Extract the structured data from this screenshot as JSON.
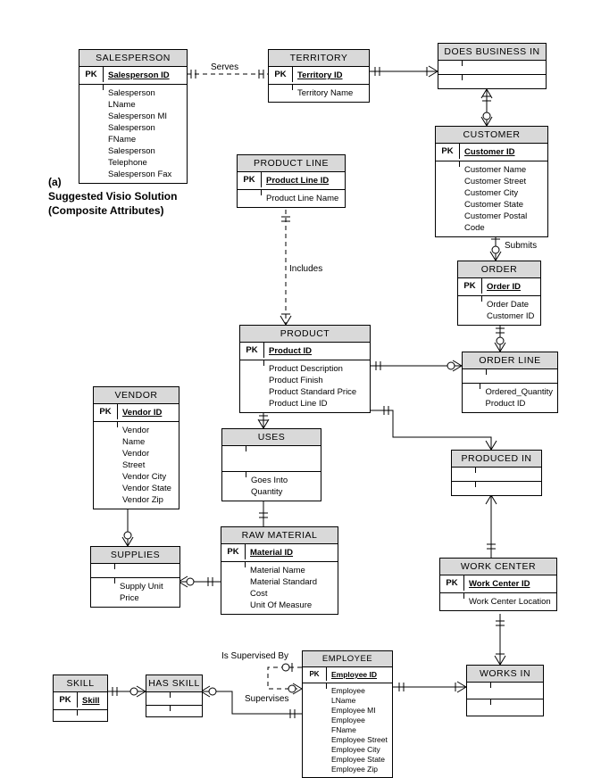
{
  "caption": {
    "a": "(a)",
    "l1": "Suggested Visio Solution",
    "l2": "(Composite Attributes)"
  },
  "labels": {
    "serves": "Serves",
    "includes": "Includes",
    "submits": "Submits",
    "supervisedBy": "Is Supervised By",
    "supervises": "Supervises"
  },
  "pk": "PK",
  "salesperson": {
    "title": "SALESPERSON",
    "key": "Salesperson ID",
    "attrs": "Salesperson LName\nSalesperson MI\nSalesperson FName\nSalesperson Telephone\nSalesperson Fax"
  },
  "territory": {
    "title": "TERRITORY",
    "key": "Territory ID",
    "attrs": "Territory Name"
  },
  "doesBusinessIn": {
    "title": "DOES BUSINESS IN"
  },
  "customer": {
    "title": "CUSTOMER",
    "key": "Customer ID",
    "attrs": "Customer Name\nCustomer Street\nCustomer City\nCustomer State\nCustomer Postal Code"
  },
  "productLine": {
    "title": "PRODUCT LINE",
    "key": "Product Line ID",
    "attrs": "Product Line Name"
  },
  "order": {
    "title": "ORDER",
    "key": "Order ID",
    "attrs": "Order Date\nCustomer ID"
  },
  "orderLine": {
    "title": "ORDER LINE",
    "attrs": "Ordered_Quantity\nProduct ID"
  },
  "product": {
    "title": "PRODUCT",
    "key": "Product ID",
    "attrs": "Product Description\nProduct Finish\nProduct Standard Price\nProduct Line ID"
  },
  "vendor": {
    "title": "VENDOR",
    "key": "Vendor ID",
    "attrs": "Vendor Name\nVendor Street\nVendor City\nVendor State\nVendor Zip"
  },
  "uses": {
    "title": "USES",
    "attrs": "Goes Into Quantity"
  },
  "producedIn": {
    "title": "PRODUCED IN"
  },
  "supplies": {
    "title": "SUPPLIES",
    "attrs": "Supply Unit Price"
  },
  "rawMaterial": {
    "title": "RAW MATERIAL",
    "key": "Material ID",
    "attrs": "Material Name\nMaterial Standard Cost\nUnit Of Measure"
  },
  "workCenter": {
    "title": "WORK CENTER",
    "key": "Work Center ID",
    "attrs": "Work Center Location"
  },
  "skill": {
    "title": "SKILL",
    "key": "Skill"
  },
  "hasSkill": {
    "title": "HAS SKILL"
  },
  "employee": {
    "title": "EMPLOYEE",
    "key": "Employee ID",
    "attrs": "Employee LName\nEmployee MI\nEmployee FName\nEmployee Street\nEmployee City\nEmployee State\nEmployee Zip"
  },
  "worksIn": {
    "title": "WORKS IN"
  }
}
